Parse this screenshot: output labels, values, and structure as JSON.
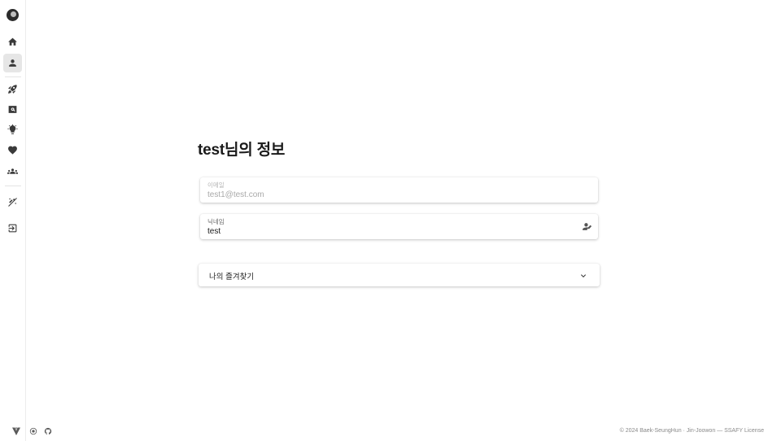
{
  "sidebar": {
    "logo": "app-logo",
    "items": [
      {
        "name": "home-icon",
        "label": "home"
      },
      {
        "name": "person-icon",
        "label": "profile",
        "active": true
      },
      {
        "name": "rocket-icon",
        "label": "rocket"
      },
      {
        "name": "image-search-icon",
        "label": "image-search"
      },
      {
        "name": "lightbulb-icon",
        "label": "ideas"
      },
      {
        "name": "heart-icon",
        "label": "favorites"
      },
      {
        "name": "groups-icon",
        "label": "groups"
      },
      {
        "name": "no-magic-icon",
        "label": "magic-off"
      },
      {
        "name": "logout-icon",
        "label": "logout"
      }
    ]
  },
  "bottom_icons": [
    "vuetify-icon",
    "settings-circle-icon",
    "github-icon"
  ],
  "main": {
    "title": "test님의 정보",
    "email": {
      "label": "이메일",
      "value": "test1@test.com"
    },
    "nickname": {
      "label": "닉네임",
      "value": "test",
      "icon": "edit-person-icon"
    },
    "favorites_panel": {
      "label": "나의 즐겨찾기",
      "icon": "chevron-down-icon"
    }
  },
  "footer": {
    "text": "© 2024 Baek-SeungHun · Jin-Joowon — SSAFY License"
  },
  "colors": {
    "active_nav_bg": "#e6e6e6",
    "icon": "#3a3a3a",
    "text": "#1a1a1a",
    "muted": "#a9a9a9"
  }
}
